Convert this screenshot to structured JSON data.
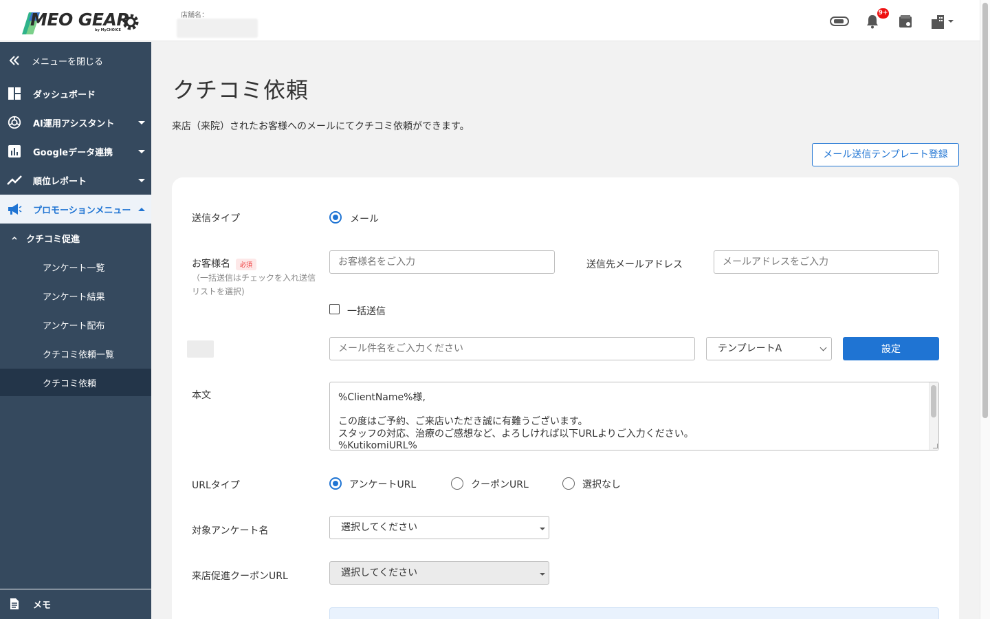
{
  "brand": {
    "logo_text": "MEO GEAR",
    "logo_sub": "by MyCHOICE",
    "accent": "#1f74d3",
    "sidebar_bg": "#35495e"
  },
  "header": {
    "store_label": "店舗名：",
    "notification_badge": "9+",
    "icons": [
      "toggle-icon",
      "bell-icon",
      "store-icon",
      "building-icon",
      "chevron-down-icon"
    ]
  },
  "sidebar": {
    "close_label": "メニューを閉じる",
    "items": [
      {
        "label": "ダッシュボード",
        "icon": "dashboard-icon"
      },
      {
        "label": "AI運用アシスタント",
        "icon": "ai-icon"
      },
      {
        "label": "Googleデータ連携",
        "icon": "chart-icon"
      },
      {
        "label": "順位レポート",
        "icon": "trend-icon"
      },
      {
        "label": "プロモーションメニュー",
        "icon": "megaphone-icon"
      }
    ],
    "group_label": "クチコミ促進",
    "sub_items": [
      "アンケート一覧",
      "アンケート結果",
      "アンケート配布",
      "クチコミ依頼一覧",
      "クチコミ依頼"
    ],
    "memo_label": "メモ"
  },
  "page": {
    "title": "クチコミ依頼",
    "description": "来店（来院）されたお客様へのメールにてクチコミ依頼ができます。",
    "template_button": "メール送信テンプレート登録"
  },
  "form": {
    "send_type_label": "送信タイプ",
    "send_type_option": "メール",
    "customer_label": "お客様名",
    "required_badge": "必須",
    "customer_hint": "（一括送信はチェックを入れ送信リストを選択)",
    "customer_placeholder": "お客様名をご入力",
    "email_label": "送信先メールアドレス",
    "email_placeholder": "メールアドレスをご入力",
    "bulk_label": "一括送信",
    "subject_placeholder": "メール件名をご入力ください",
    "template_select": "テンプレートA",
    "set_button": "設定",
    "body_label": "本文",
    "body_text": "%ClientName%様,\n\nこの度はご予約、ご来店いただき誠に有難うございます。\nスタッフの対応、治療のご感想など、よろしければ以下URLよりご入力ください。\n%KutikomiURL%",
    "url_type_label": "URLタイプ",
    "url_options": [
      "アンケートURL",
      "クーポンURL",
      "選択なし"
    ],
    "survey_label": "対象アンケート名",
    "survey_select": "選択してください",
    "coupon_label": "来店促進クーポンURL",
    "coupon_select": "選択してください"
  }
}
